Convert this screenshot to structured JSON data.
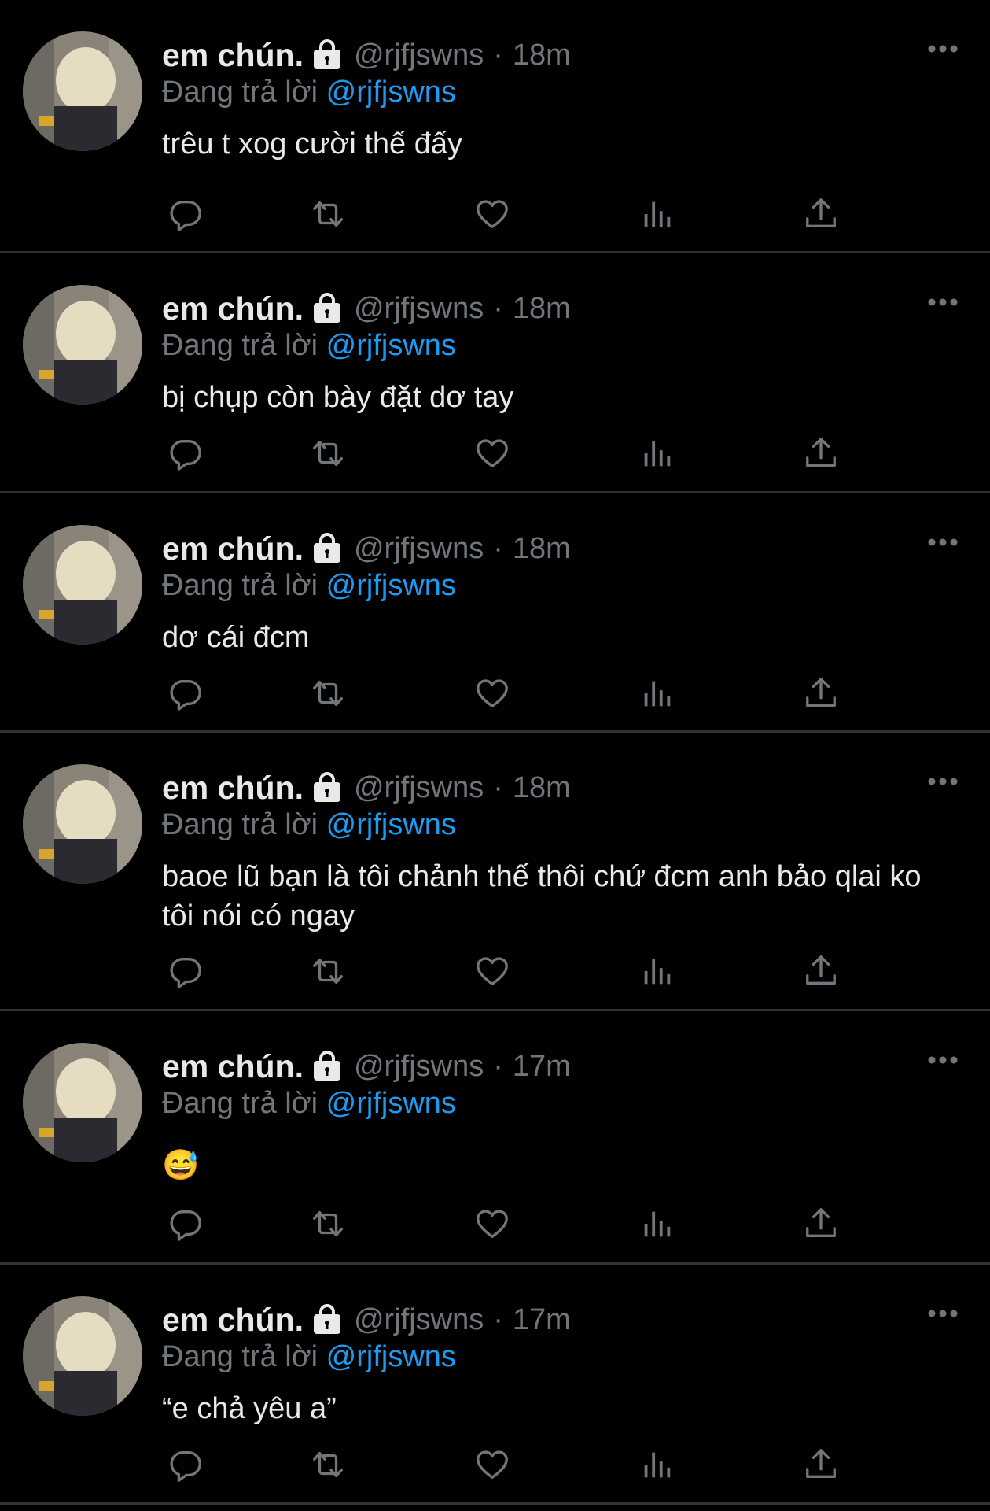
{
  "colors": {
    "background": "#000000",
    "primary_text": "#e7e9ea",
    "secondary_text": "#71767b",
    "mention": "#1d9bf0",
    "divider": "#2f3336"
  },
  "tweets": [
    {
      "name": "em chún.",
      "handle": "@rjfjswns",
      "separator": "·",
      "time": "18m",
      "reply_prefix": "Đang trả lời",
      "reply_to": "@rjfjswns",
      "text": "trêu t xog cười thế đấy"
    },
    {
      "name": "em chún.",
      "handle": "@rjfjswns",
      "separator": "·",
      "time": "18m",
      "reply_prefix": "Đang trả lời",
      "reply_to": "@rjfjswns",
      "text": "bị chụp còn bày đặt dơ tay"
    },
    {
      "name": "em chún.",
      "handle": "@rjfjswns",
      "separator": "·",
      "time": "18m",
      "reply_prefix": "Đang trả lời",
      "reply_to": "@rjfjswns",
      "text": "dơ cái đcm"
    },
    {
      "name": "em chún.",
      "handle": "@rjfjswns",
      "separator": "·",
      "time": "18m",
      "reply_prefix": "Đang trả lời",
      "reply_to": "@rjfjswns",
      "text": "baoe lũ bạn là tôi chảnh thế thôi chứ đcm anh bảo qlai ko tôi nói có ngay"
    },
    {
      "name": "em chún.",
      "handle": "@rjfjswns",
      "separator": "·",
      "time": "17m",
      "reply_prefix": "Đang trả lời",
      "reply_to": "@rjfjswns",
      "text": "😅"
    },
    {
      "name": "em chún.",
      "handle": "@rjfjswns",
      "separator": "·",
      "time": "17m",
      "reply_prefix": "Đang trả lời",
      "reply_to": "@rjfjswns",
      "text": "“e chả yêu a”"
    }
  ],
  "icons": {
    "lock": "lock-icon",
    "more": "more-options-icon",
    "reply": "reply-icon",
    "retweet": "retweet-icon",
    "like": "like-icon",
    "views": "views-icon",
    "share": "share-icon"
  }
}
